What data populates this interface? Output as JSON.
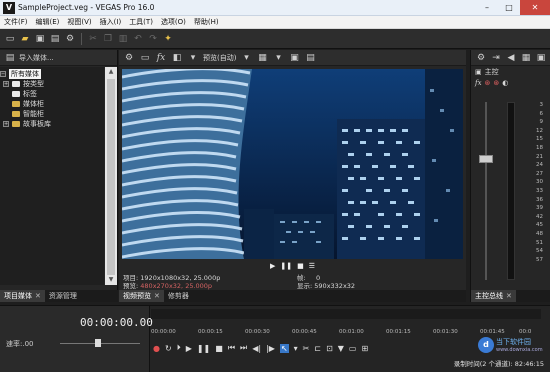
{
  "window": {
    "title": "SampleProject.veg - VEGAS Pro 16.0",
    "controls": [
      "–",
      "□",
      "✕"
    ]
  },
  "menu": [
    "文件(F)",
    "编辑(E)",
    "视图(V)",
    "插入(I)",
    "工具(T)",
    "选项(O)",
    "帮助(H)"
  ],
  "media_panel": {
    "import_label": "导入媒体...",
    "tree": [
      {
        "label": "所有媒体",
        "selected": true
      },
      {
        "label": "按类型"
      },
      {
        "label": "标签"
      },
      {
        "label": "媒体柜"
      },
      {
        "label": "智能柜"
      },
      {
        "label": "故事板库"
      }
    ],
    "tabs": [
      "项目媒体",
      "资源管理"
    ]
  },
  "preview": {
    "mode": "预览(自动)",
    "info": {
      "project_label": "项目:",
      "project_value": "1920x1080x32, 25.000p",
      "preview_label": "预览:",
      "preview_value": "480x270x32, 25.000p",
      "frame_label": "帧:",
      "frame_value": "0",
      "display_label": "显示:",
      "display_value": "590x332x32"
    },
    "tabs": [
      "视频预览",
      "修剪器"
    ]
  },
  "mixer": {
    "master_label": "主控",
    "scale": [
      "3",
      "6",
      "9",
      "12",
      "15",
      "18",
      "21",
      "24",
      "27",
      "30",
      "33",
      "36",
      "39",
      "42",
      "45",
      "48",
      "51",
      "54",
      "57"
    ],
    "tabs": [
      "主控总线"
    ]
  },
  "timeline": {
    "timecode": "00:00:00.00",
    "rate_label": "速率:.00",
    "ruler": [
      "00:00:00",
      "00:00:15",
      "00:00:30",
      "00:00:45",
      "00:01:00",
      "00:01:15",
      "00:01:30",
      "00:01:45",
      "00:0"
    ],
    "status": "录制时间(2 个通道): 82:46:15"
  },
  "watermark": {
    "title": "当下软件园",
    "sub": "www.downxia.com"
  },
  "colors": {
    "panel": "#262626",
    "accent": "#3878c8",
    "highlight_red": "#d36262"
  }
}
